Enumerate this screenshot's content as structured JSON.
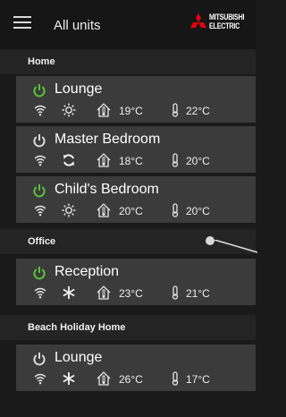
{
  "header": {
    "title": "All units",
    "logo": "MITSUBISHI ELECTRIC",
    "logo_line1": "MITSUBISHI",
    "logo_line2": "ELECTRIC",
    "menu_icon": "hamburger-menu-icon"
  },
  "sections": [
    {
      "name": "Home"
    },
    {
      "name": "Office"
    },
    {
      "name": "Beach Holiday Home"
    }
  ],
  "units": [
    {
      "room": "Lounge",
      "power": "on",
      "mode": "sun",
      "indoor": "19°C",
      "setpoint": "22°C"
    },
    {
      "room": "Master Bedroom",
      "power": "off",
      "mode": "auto",
      "indoor": "18°C",
      "setpoint": "20°C"
    },
    {
      "room": "Child's Bedroom",
      "power": "on",
      "mode": "sun",
      "indoor": "20°C",
      "setpoint": "20°C"
    },
    {
      "room": "Reception",
      "power": "on",
      "mode": "snow",
      "indoor": "23°C",
      "setpoint": "21°C"
    },
    {
      "room": "Lounge",
      "power": "off",
      "mode": "snow",
      "indoor": "26°C",
      "setpoint": "17°C"
    }
  ],
  "colors": {
    "power_on": "#5cc23c",
    "power_off": "#d8d8d8",
    "brand_red": "#e60012"
  }
}
